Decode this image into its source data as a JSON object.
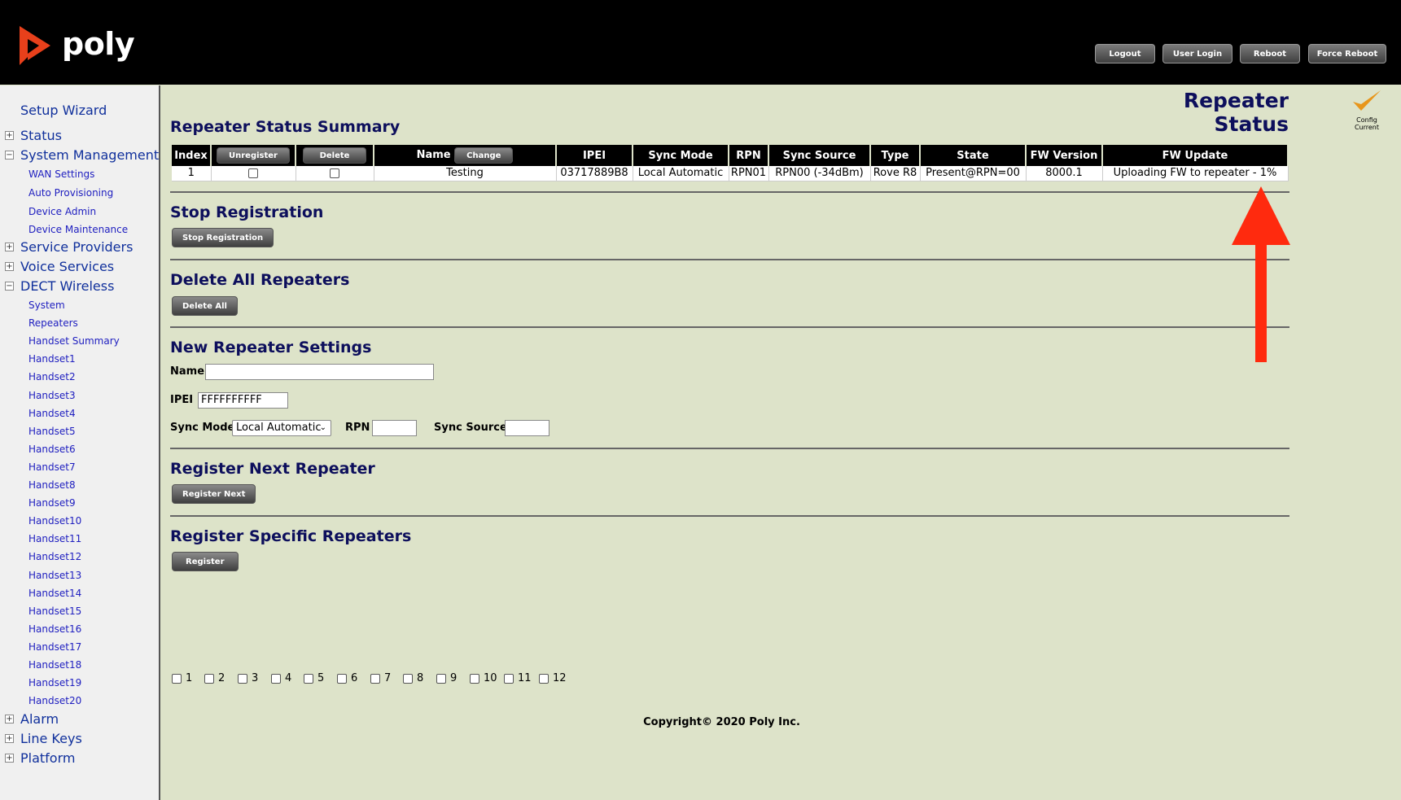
{
  "brand": {
    "name": "poly",
    "accent": "#e8401b"
  },
  "header_buttons": [
    "Logout",
    "User Login",
    "Reboot",
    "Force Reboot"
  ],
  "sidebar": {
    "setup_wizard": "Setup Wizard",
    "status": "Status",
    "system_management": "System Management",
    "sm_items": [
      "WAN Settings",
      "Auto Provisioning",
      "Device Admin",
      "Device Maintenance"
    ],
    "service_providers": "Service Providers",
    "voice_services": "Voice Services",
    "dect_wireless": "DECT Wireless",
    "dect_items": [
      "System",
      "Repeaters",
      "Handset Summary",
      "Handset1",
      "Handset2",
      "Handset3",
      "Handset4",
      "Handset5",
      "Handset6",
      "Handset7",
      "Handset8",
      "Handset9",
      "Handset10",
      "Handset11",
      "Handset12",
      "Handset13",
      "Handset14",
      "Handset15",
      "Handset16",
      "Handset17",
      "Handset18",
      "Handset19",
      "Handset20"
    ],
    "alarm": "Alarm",
    "line_keys": "Line Keys",
    "platform": "Platform"
  },
  "page": {
    "title": "Repeater Status",
    "config_status": "Config Current"
  },
  "summary": {
    "heading": "Repeater Status Summary",
    "headers": {
      "index": "Index",
      "unregister": "Unregister",
      "delete": "Delete",
      "name": "Name",
      "change": "Change",
      "ipei": "IPEI",
      "sync_mode": "Sync Mode",
      "rpn": "RPN",
      "sync_source": "Sync Source",
      "type": "Type",
      "state": "State",
      "fw_version": "FW Version",
      "fw_update": "FW Update"
    },
    "row": {
      "index": "1",
      "name": "Testing",
      "ipei": "03717889B8",
      "sync_mode": "Local Automatic",
      "rpn": "RPN01",
      "sync_source": "RPN00 (-34dBm)",
      "type": "Rove R8",
      "state": "Present@RPN=00",
      "fw_version": "8000.1",
      "fw_update": "Uploading FW to repeater - 1%"
    }
  },
  "stop": {
    "heading": "Stop Registration",
    "button": "Stop Registration"
  },
  "delete_all": {
    "heading": "Delete All Repeaters",
    "button": "Delete All"
  },
  "new_settings": {
    "heading": "New Repeater Settings",
    "name_label": "Name",
    "name_value": "",
    "ipei_label": "IPEI",
    "ipei_value": "FFFFFFFFFF",
    "sync_mode_label": "Sync Mode",
    "sync_mode_value": "Local Automatic",
    "rpn_label": "RPN",
    "rpn_value": "",
    "sync_source_label": "Sync Source",
    "sync_source_value": ""
  },
  "register_next": {
    "heading": "Register Next Repeater",
    "button": "Register Next"
  },
  "register_specific": {
    "heading": "Register Specific Repeaters",
    "button": "Register",
    "checkboxes": [
      "1",
      "2",
      "3",
      "4",
      "5",
      "6",
      "7",
      "8",
      "9",
      "10",
      "11",
      "12"
    ]
  },
  "copyright": "Copyright© 2020 Poly Inc.",
  "annotation_color": "#ff2a0e"
}
